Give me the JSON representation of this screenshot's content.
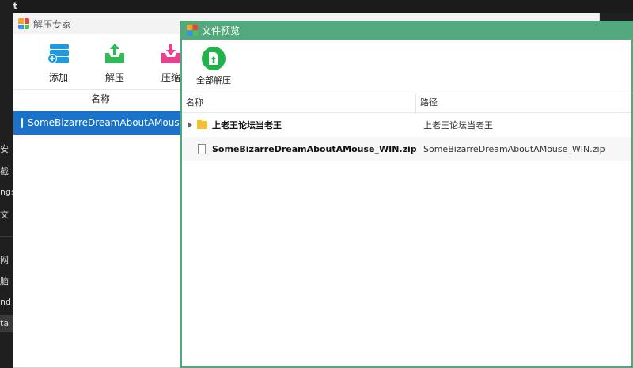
{
  "background": {
    "top_label": "Net",
    "side_items": [
      "安",
      "截",
      "ngs",
      "文",
      "网",
      "脑",
      "nd",
      "ta"
    ]
  },
  "main_window": {
    "title": "解压专家",
    "toolbar": {
      "add_label": "添加",
      "extract_label": "解压",
      "compress_label": "压缩"
    },
    "list_header": "名称",
    "files": [
      {
        "name": "SomeBizarreDreamAboutAMouse.zip"
      }
    ]
  },
  "preview_window": {
    "title": "文件预览",
    "extract_all_label": "全部解压",
    "columns": {
      "name": "名称",
      "path": "路径"
    },
    "rows": [
      {
        "type": "folder",
        "name": "上老王论坛当老王",
        "path": "上老王论坛当老王"
      },
      {
        "type": "file",
        "name": "SomeBizarreDreamAboutAMouse_WIN.zip",
        "path": "SomeBizarreDreamAboutAMouse_WIN.zip"
      }
    ]
  },
  "colors": {
    "accent_green": "#53a97b",
    "selection_blue": "#1a73c9",
    "add_icon": "#1e9be0",
    "extract_icon": "#2dbb55",
    "compress_icon": "#e8428f"
  }
}
